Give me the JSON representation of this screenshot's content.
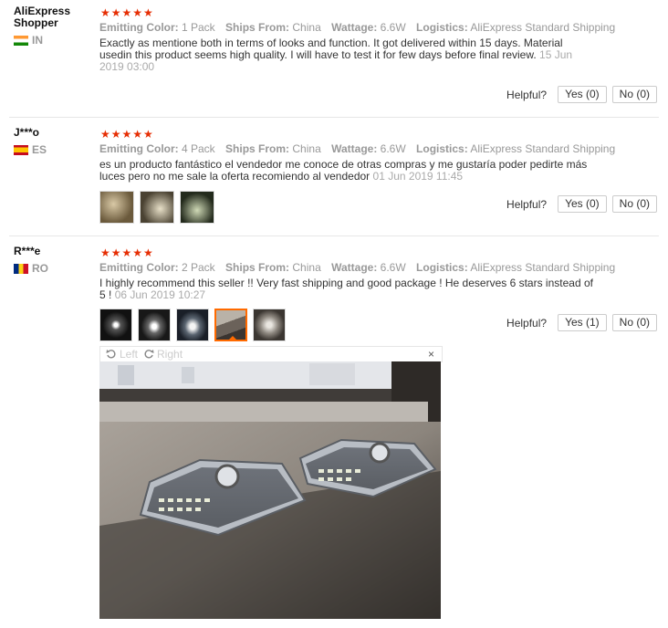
{
  "reviews": [
    {
      "user": "AliExpress Shopper",
      "country": "IN",
      "stars": "★★★★★",
      "attr": {
        "color_label": "Emitting Color:",
        "color": "1 Pack",
        "ships_label": "Ships From:",
        "ships": "China",
        "watt_label": "Wattage:",
        "watt": "6.6W",
        "log_label": "Logistics:",
        "log": "AliExpress Standard Shipping"
      },
      "text": "Exactly as mentione both in terms of looks and function. It got delivered within 15 days. Material usedin this product seems high quality. I will have to test it for few days before final review.",
      "date": "15 Jun 2019 03:00",
      "helpful": "Helpful?",
      "yes": "Yes (0)",
      "no": "No (0)"
    },
    {
      "user": "J***o",
      "country": "ES",
      "stars": "★★★★★",
      "attr": {
        "color_label": "Emitting Color:",
        "color": "4 Pack",
        "ships_label": "Ships From:",
        "ships": "China",
        "watt_label": "Wattage:",
        "watt": "6.6W",
        "log_label": "Logistics:",
        "log": "AliExpress Standard Shipping"
      },
      "text": "es un producto fantástico el vendedor me conoce de otras compras y me gustaría poder pedirte más luces pero no me sale la oferta recomiendo al vendedor",
      "date": "01 Jun 2019 11:45",
      "helpful": "Helpful?",
      "yes": "Yes (0)",
      "no": "No (0)"
    },
    {
      "user": "R***e",
      "country": "RO",
      "stars": "★★★★★",
      "attr": {
        "color_label": "Emitting Color:",
        "color": "2 Pack",
        "ships_label": "Ships From:",
        "ships": "China",
        "watt_label": "Wattage:",
        "watt": "6.6W",
        "log_label": "Logistics:",
        "log": "AliExpress Standard Shipping"
      },
      "text": "I highly recommend this seller !! Very fast shipping and good package ! He deserves 6 stars instead of 5 !",
      "date": "06 Jun 2019 10:27",
      "helpful": "Helpful?",
      "yes": "Yes (1)",
      "no": "No (0)"
    }
  ],
  "viewer": {
    "left": "Left",
    "right": "Right",
    "close": "×"
  },
  "colors": {
    "star": "#e62e04",
    "muted": "#999999",
    "selected": "#ff6a00"
  }
}
